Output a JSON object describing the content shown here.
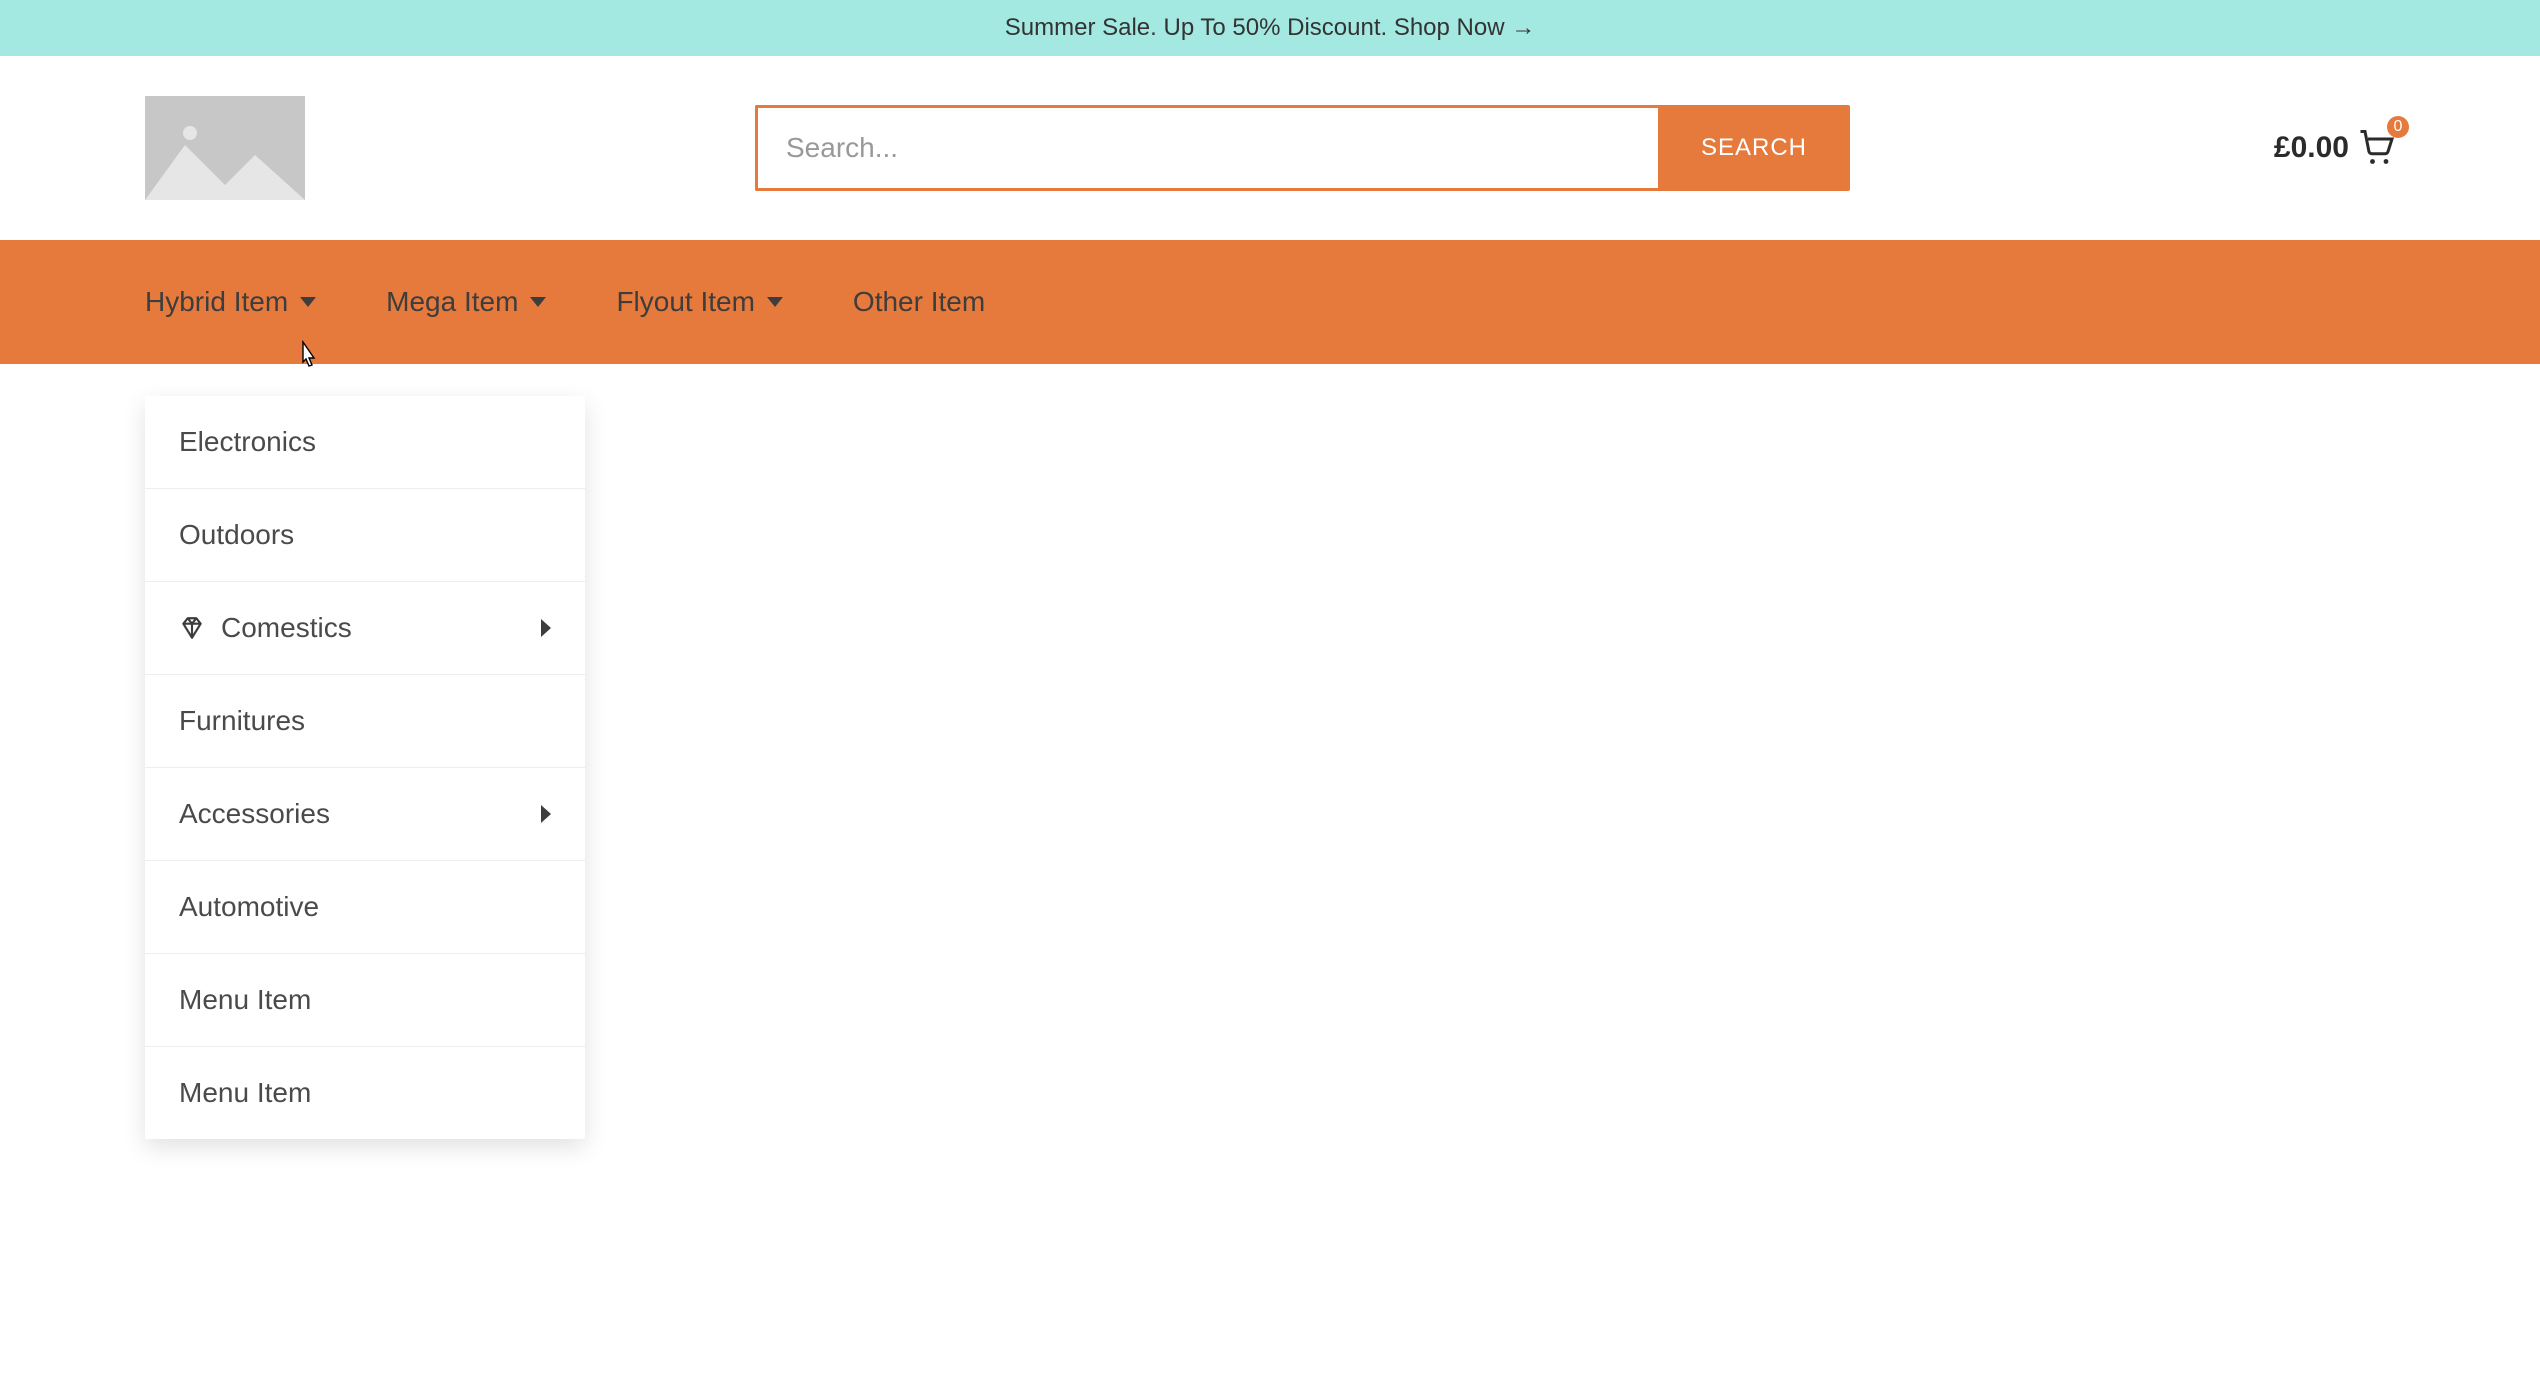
{
  "announce": {
    "text": "Summer Sale. Up To 50% Discount. Shop Now →"
  },
  "search": {
    "placeholder": "Search...",
    "button": "SEARCH"
  },
  "cart": {
    "amount": "£0.00",
    "badge": "0"
  },
  "nav": {
    "items": [
      {
        "label": "Hybrid Item",
        "has_caret": true
      },
      {
        "label": "Mega Item",
        "has_caret": true
      },
      {
        "label": "Flyout Item",
        "has_caret": true
      },
      {
        "label": "Other Item",
        "has_caret": false
      }
    ]
  },
  "dropdown": {
    "items": [
      {
        "label": "Electronics",
        "icon": null,
        "has_sub": false
      },
      {
        "label": "Outdoors",
        "icon": null,
        "has_sub": false
      },
      {
        "label": "Comestics",
        "icon": "diamond",
        "has_sub": true
      },
      {
        "label": "Furnitures",
        "icon": null,
        "has_sub": false
      },
      {
        "label": "Accessories",
        "icon": null,
        "has_sub": true
      },
      {
        "label": "Automotive",
        "icon": null,
        "has_sub": false
      },
      {
        "label": "Menu Item",
        "icon": null,
        "has_sub": false
      },
      {
        "label": "Menu Item",
        "icon": null,
        "has_sub": false
      }
    ]
  },
  "colors": {
    "accent": "#e67a3c",
    "announce_bg": "#a3e9e1"
  }
}
